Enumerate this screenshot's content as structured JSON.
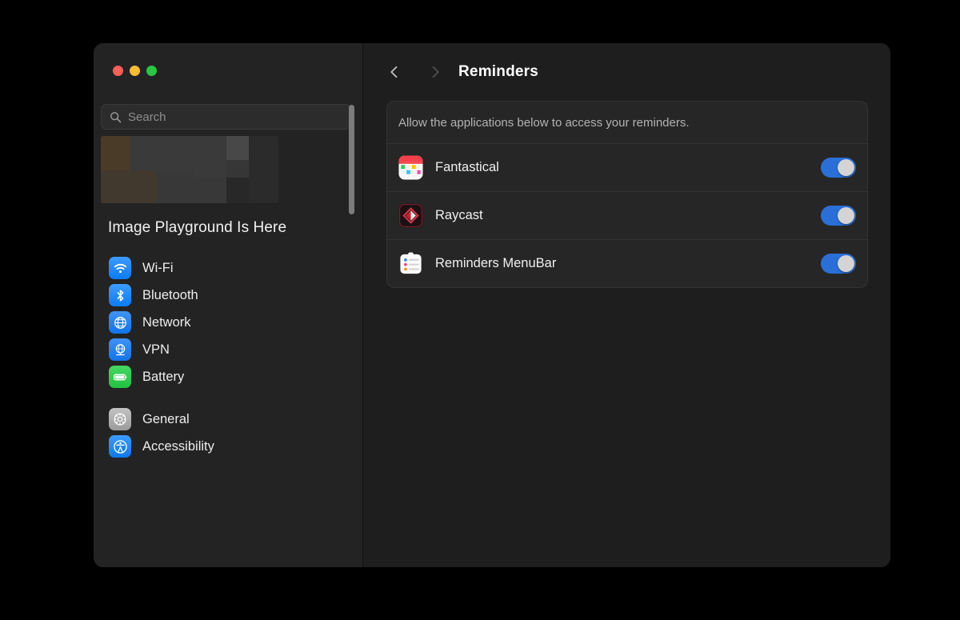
{
  "window": {
    "traffic_lights": [
      {
        "name": "close",
        "color": "#ff5f57"
      },
      {
        "name": "minimize",
        "color": "#febc2e"
      },
      {
        "name": "zoom",
        "color": "#28c840"
      }
    ]
  },
  "sidebar": {
    "search": {
      "placeholder": "Search",
      "value": "",
      "icon": "search-icon"
    },
    "promo": {
      "title": "Image Playground Is Here",
      "banner_icon": "pixelated-promo-image"
    },
    "groups": [
      {
        "items": [
          {
            "label": "Wi-Fi",
            "icon": "wifi-icon",
            "color": "#0a7cf5"
          },
          {
            "label": "Bluetooth",
            "icon": "bluetooth-icon",
            "color": "#0a7cf5"
          },
          {
            "label": "Network",
            "icon": "globe-icon",
            "color": "#1273e8"
          },
          {
            "label": "VPN",
            "icon": "vpn-globe-icon",
            "color": "#1273e8"
          },
          {
            "label": "Battery",
            "icon": "battery-icon",
            "color": "#21c141"
          }
        ]
      },
      {
        "items": [
          {
            "label": "General",
            "icon": "gear-icon",
            "color": "#9b9b9b"
          },
          {
            "label": "Accessibility",
            "icon": "accessibility-icon",
            "color": "#0d78ef"
          }
        ]
      }
    ],
    "scrollbar": {
      "name": "sidebar-scrollbar"
    }
  },
  "content": {
    "nav": {
      "back_icon": "chevron-left-icon",
      "forward_icon": "chevron-right-icon"
    },
    "title": "Reminders",
    "card": {
      "note": "Allow the applications below to access your reminders.",
      "apps": [
        {
          "name": "Fantastical",
          "icon": "fantastical-app-icon",
          "enabled": true
        },
        {
          "name": "Raycast",
          "icon": "raycast-app-icon",
          "enabled": true
        },
        {
          "name": "Reminders MenuBar",
          "icon": "reminders-menubar-app-icon",
          "enabled": true
        }
      ]
    }
  },
  "colors": {
    "accent": "#2a6fd8",
    "window_bg": "#1e1e1e",
    "sidebar_bg": "#232323",
    "card_bg": "#262626"
  }
}
